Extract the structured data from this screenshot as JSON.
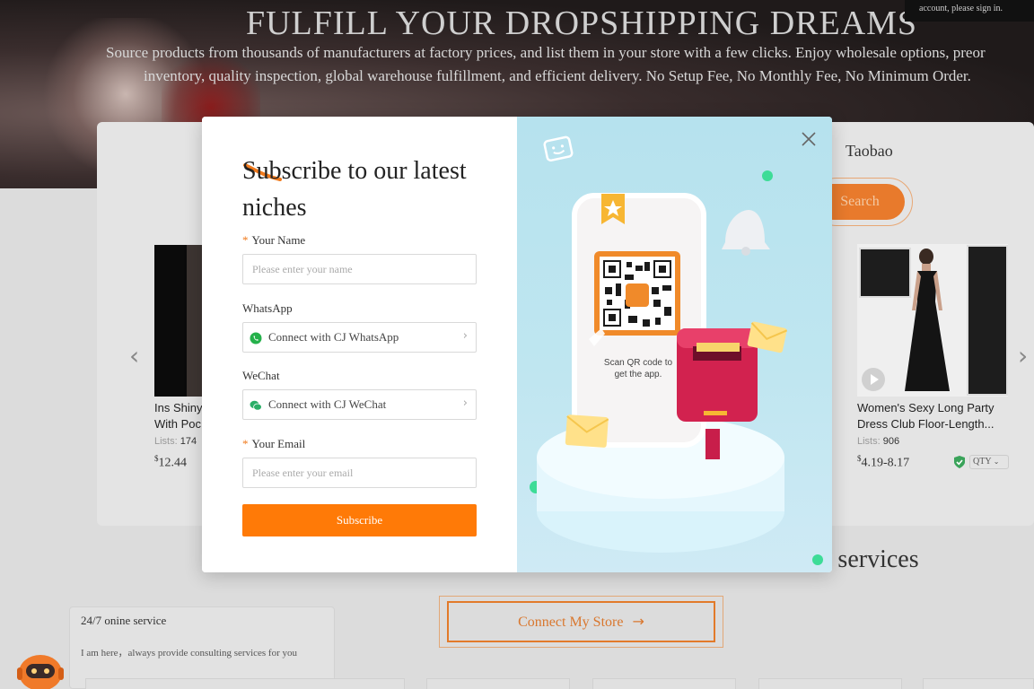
{
  "hero": {
    "title": "FULFILL YOUR DROPSHIPPING DREAMS",
    "subtitle_line1": "Source products from thousands of manufacturers at factory prices, and list them in your store with a few clicks. Enjoy wholesale options, preor",
    "subtitle_line2": "inventory, quality inspection, global warehouse fulfillment, and efficient delivery. No Setup Fee, No Monthly Fee, No Minimum Order.",
    "signin_notice": "account, please sign in."
  },
  "search": {
    "tab_taobao": "Taobao",
    "search_button": "Search"
  },
  "products": [
    {
      "name_line1": "Ins Shiny",
      "name_line2": "With Poc",
      "lists_label": "Lists:",
      "lists_value": "174",
      "price_symbol": "$",
      "price": "12.44"
    },
    {
      "name_line1": "Women's Sexy Long Party",
      "name_line2": "Dress Club Floor-Length...",
      "lists_label": "Lists:",
      "lists_value": "906",
      "price_symbol": "$",
      "price": "4.19-8.17",
      "qty_label": "QTY"
    }
  ],
  "services": {
    "heading_fragment": "e services",
    "connect_store_button": "Connect My Store",
    "connect_arrow": "→"
  },
  "chat": {
    "title": "24/7 onine service",
    "message": "I am here，always provide consulting services for you"
  },
  "modal": {
    "title": "Subscribe to our latest niches",
    "name_label": "Your Name",
    "name_placeholder": "Please enter your name",
    "whatsapp_label": "WhatsApp",
    "whatsapp_button": "Connect with CJ WhatsApp",
    "wechat_label": "WeChat",
    "wechat_button": "Connect with CJ WeChat",
    "email_label": "Your Email",
    "email_placeholder": "Please enter your email",
    "subscribe_button": "Subscribe",
    "required_mark": "*",
    "chevron": "›",
    "scan_text": "Scan QR code to get the app.",
    "accent_color": "#ff7a07",
    "illustration_bg": "#b6e2ee"
  }
}
